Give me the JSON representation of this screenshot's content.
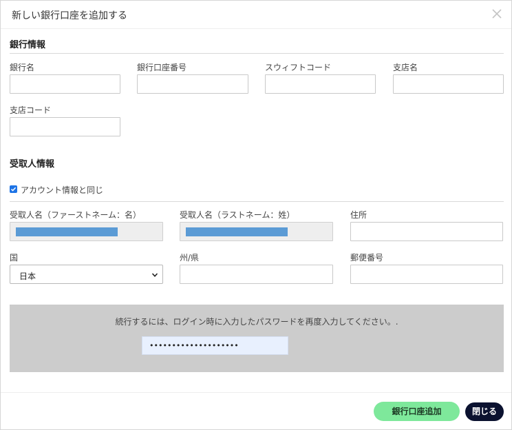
{
  "modal": {
    "title": "新しい銀行口座を追加する"
  },
  "bank_info": {
    "section_title": "銀行情報",
    "bank_name_label": "銀行名",
    "account_number_label": "銀行口座番号",
    "swift_code_label": "スウィフトコード",
    "branch_name_label": "支店名",
    "branch_code_label": "支店コード"
  },
  "recipient_info": {
    "section_title": "受取人情報",
    "same_as_account_label": "アカウント情報と同じ",
    "same_as_account_checked": true,
    "first_name_label": "受取人名（ファーストネーム：名）",
    "last_name_label": "受取人名（ラストネーム：姓）",
    "address_label": "住所",
    "country_label": "国",
    "country_value": "日本",
    "state_label": "州/県",
    "postal_code_label": "郵便番号"
  },
  "password": {
    "message": "続行するには、ログイン時に入力したパスワードを再度入力してください。.",
    "masked_value": "••••••••••••••••••••"
  },
  "footer": {
    "add_button_label": "銀行口座追加",
    "close_button_label": "閉じる"
  },
  "colors": {
    "add_button": "#7ee89b",
    "close_button": "#0b1230",
    "checkbox": "#1e74e6",
    "redaction": "#5b9bd5",
    "password_panel": "#cccccc"
  }
}
